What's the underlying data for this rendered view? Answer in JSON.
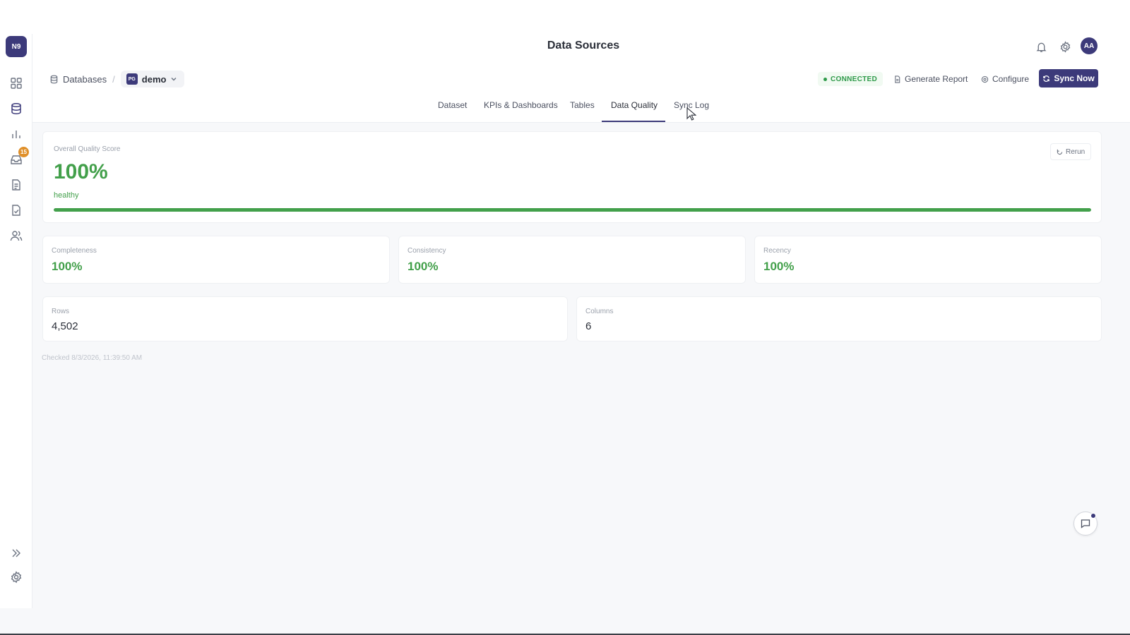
{
  "app": {
    "logo": "N9"
  },
  "header": {
    "title": "Data Sources",
    "avatar_initials": "AA"
  },
  "sidebar": {
    "items": [
      {
        "name": "dashboard-grid-icon"
      },
      {
        "name": "database-icon",
        "active": true
      },
      {
        "name": "bar-chart-icon"
      },
      {
        "name": "inbox-icon",
        "badge": "15"
      },
      {
        "name": "document-icon"
      },
      {
        "name": "checklist-document-icon"
      },
      {
        "name": "users-icon"
      }
    ],
    "expand_icon": "double-chevron-right-icon",
    "settings_icon": "gear-icon"
  },
  "breadcrumb": {
    "root": "Databases",
    "db_tag": "PG",
    "db_name": "demo"
  },
  "status": {
    "label": "CONNECTED",
    "color": "#2f9a4a"
  },
  "actions": {
    "generate_report": "Generate Report",
    "configure": "Configure",
    "sync_now": "Sync Now"
  },
  "tabs": [
    {
      "label": "Dataset"
    },
    {
      "label": "KPIs & Dashboards"
    },
    {
      "label": "Tables"
    },
    {
      "label": "Data Quality",
      "active": true
    },
    {
      "label": "Sync Log"
    }
  ],
  "overall": {
    "label": "Overall Quality Score",
    "score": "100%",
    "status": "healthy",
    "rerun_label": "Rerun",
    "progress": 1.0
  },
  "metrics": [
    {
      "label": "Completeness",
      "value": "100%"
    },
    {
      "label": "Consistency",
      "value": "100%"
    },
    {
      "label": "Recency",
      "value": "100%"
    }
  ],
  "stats": [
    {
      "label": "Rows",
      "value": "4,502"
    },
    {
      "label": "Columns",
      "value": "6"
    }
  ],
  "checked_text": "Checked 8/3/2026, 11:39:50 AM",
  "colors": {
    "accent": "#3c3a7a",
    "success": "#43a04b",
    "badge": "#e0902a"
  }
}
